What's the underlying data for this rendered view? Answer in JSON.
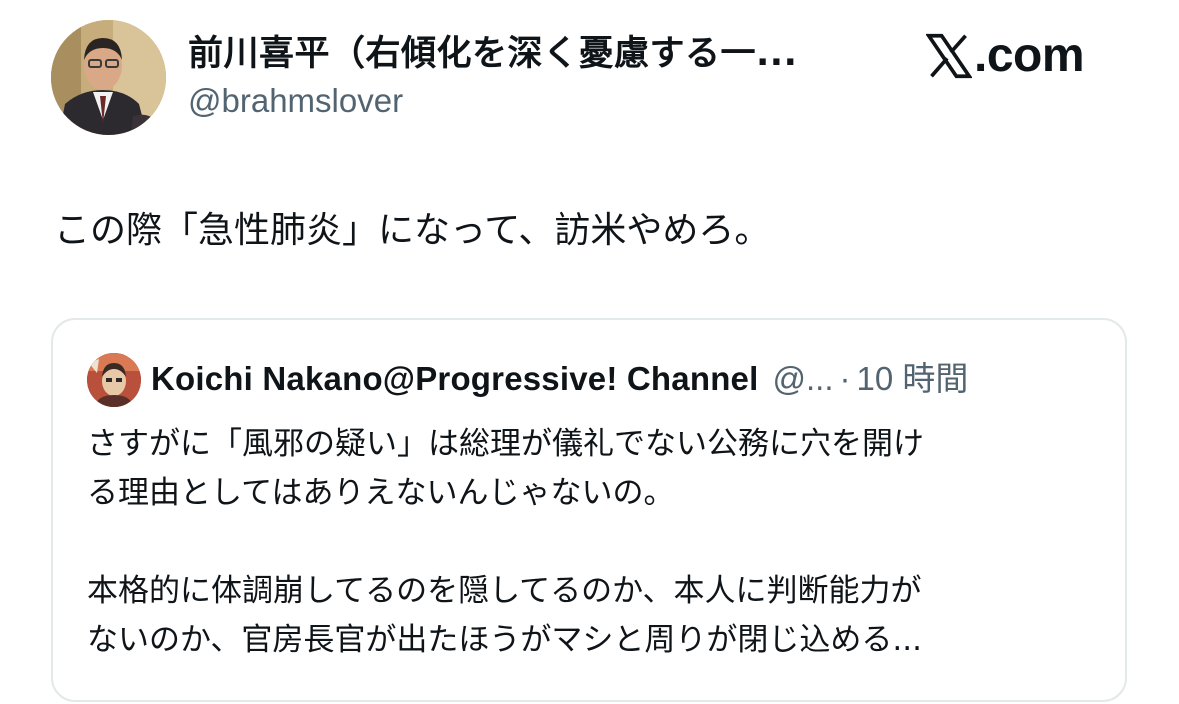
{
  "tweet": {
    "author": {
      "display_name": "前川喜平（右傾化を深く憂慮する一...",
      "handle": "@brahmslover",
      "avatar_icon": "profile-photo"
    },
    "text": "この際「急性肺炎」になって、訪米やめろ。"
  },
  "brand": {
    "icon": "x-logo-icon",
    "suffix": ".com"
  },
  "quoted_tweet": {
    "author": "Koichi Nakano@Progressive! Channel",
    "handle": "@...",
    "separator": "·",
    "time": "10 時間",
    "avatar_icon": "profile-photo",
    "lines": [
      "さすがに「風邪の疑い」は総理が儀礼でない公務に穴を開け",
      "る理由としてはありえないんじゃないの。",
      "",
      "本格的に体調崩してるのを隠してるのか、本人に判断能力が",
      "ないのか、官房長官が出たほうがマシと周りが閉じ込める..."
    ]
  },
  "colors": {
    "text": "#0f1419",
    "secondary": "#536471",
    "border": "#e3e8eb"
  }
}
